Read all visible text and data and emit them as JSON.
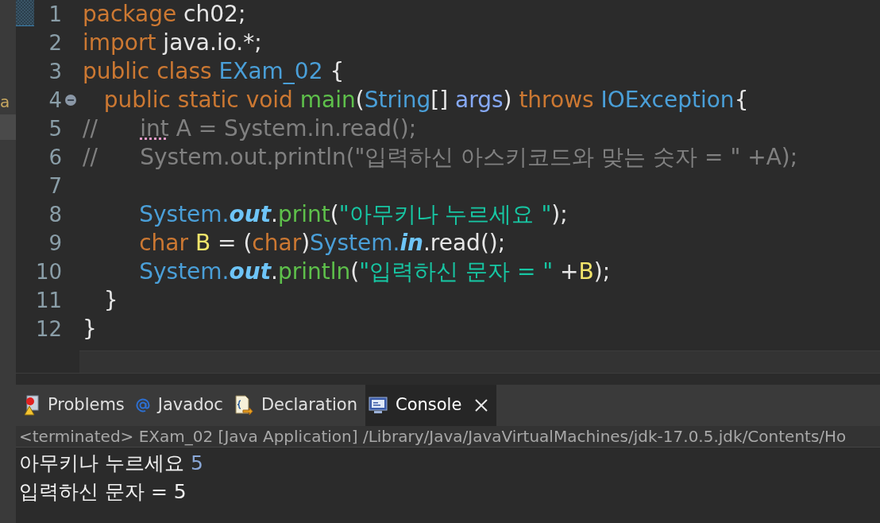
{
  "side_panel": {
    "fragment": "a"
  },
  "code_lines": [
    {
      "number": "1",
      "tokens": [
        {
          "text": "package ",
          "kind": "keyword"
        },
        {
          "text": "ch02;",
          "kind": "plain"
        }
      ]
    },
    {
      "number": "2",
      "tokens": [
        {
          "text": "import ",
          "kind": "keyword"
        },
        {
          "text": "java.io.*;",
          "kind": "plain"
        }
      ]
    },
    {
      "number": "3",
      "tokens": [
        {
          "text": "public class ",
          "kind": "keyword"
        },
        {
          "text": "EXam_02",
          "kind": "type"
        },
        {
          "text": " {",
          "kind": "plain"
        }
      ]
    },
    {
      "number": "4",
      "fold": true,
      "tokens": [
        {
          "text": "   public static void ",
          "kind": "keyword"
        },
        {
          "text": "main",
          "kind": "method"
        },
        {
          "text": "(",
          "kind": "plain"
        },
        {
          "text": "String",
          "kind": "type"
        },
        {
          "text": "[] ",
          "kind": "plain"
        },
        {
          "text": "args",
          "kind": "param"
        },
        {
          "text": ") ",
          "kind": "plain"
        },
        {
          "text": "throws ",
          "kind": "keyword"
        },
        {
          "text": "IOException",
          "kind": "type"
        },
        {
          "text": "{",
          "kind": "plain"
        }
      ]
    },
    {
      "number": "5",
      "tokens": [
        {
          "text": "//      ",
          "kind": "comment"
        },
        {
          "text": "int",
          "kind": "warning"
        },
        {
          "text": " A = System.in.read();",
          "kind": "comment"
        }
      ]
    },
    {
      "number": "6",
      "tokens": [
        {
          "text": "//      System.out.println(\"입력하신 아스키코드와 맞는 숫자 = \" +A);",
          "kind": "comment"
        }
      ]
    },
    {
      "number": "7"
    },
    {
      "number": "8",
      "tokens": [
        {
          "text": "        System.",
          "kind": "type"
        },
        {
          "text": "out",
          "kind": "field"
        },
        {
          "text": ".",
          "kind": "plain"
        },
        {
          "text": "print",
          "kind": "method"
        },
        {
          "text": "(",
          "kind": "plain"
        },
        {
          "text": "\"아무키나 누르세요 \"",
          "kind": "string"
        },
        {
          "text": ");",
          "kind": "plain"
        }
      ]
    },
    {
      "number": "9",
      "tokens": [
        {
          "text": "        char ",
          "kind": "keyword"
        },
        {
          "text": "B",
          "kind": "var"
        },
        {
          "text": " = (",
          "kind": "plain"
        },
        {
          "text": "char",
          "kind": "keyword"
        },
        {
          "text": ")",
          "kind": "plain"
        },
        {
          "text": "System.",
          "kind": "type"
        },
        {
          "text": "in",
          "kind": "field"
        },
        {
          "text": ".read();",
          "kind": "plain"
        }
      ]
    },
    {
      "number": "10",
      "tokens": [
        {
          "text": "        System.",
          "kind": "type"
        },
        {
          "text": "out",
          "kind": "field"
        },
        {
          "text": ".",
          "kind": "plain"
        },
        {
          "text": "println",
          "kind": "method"
        },
        {
          "text": "(",
          "kind": "plain"
        },
        {
          "text": "\"입력하신 문자 = \"",
          "kind": "string"
        },
        {
          "text": " +",
          "kind": "plain"
        },
        {
          "text": "B",
          "kind": "var"
        },
        {
          "text": ");",
          "kind": "plain"
        }
      ]
    },
    {
      "number": "11",
      "tokens": [
        {
          "text": "   }",
          "kind": "plain"
        }
      ]
    },
    {
      "number": "12",
      "tokens": [
        {
          "text": "}",
          "kind": "plain"
        }
      ]
    }
  ],
  "tabs": [
    {
      "label": "Problems",
      "kind": "problems",
      "selected": false
    },
    {
      "label": "Javadoc",
      "kind": "javadoc",
      "selected": false
    },
    {
      "label": "Declaration",
      "kind": "declaration",
      "selected": false
    },
    {
      "label": "Console",
      "kind": "console",
      "selected": true,
      "closable": true
    }
  ],
  "console": {
    "status": "<terminated> EXam_02 [Java Application] /Library/Java/JavaVirtualMachines/jdk-17.0.5.jdk/Contents/Ho",
    "output": [
      [
        {
          "text": "아무키나 누르세요 ",
          "kind": "output"
        },
        {
          "text": "5",
          "kind": "input"
        }
      ],
      [
        {
          "text": "입력하신 문자 = 5",
          "kind": "output"
        }
      ]
    ]
  }
}
